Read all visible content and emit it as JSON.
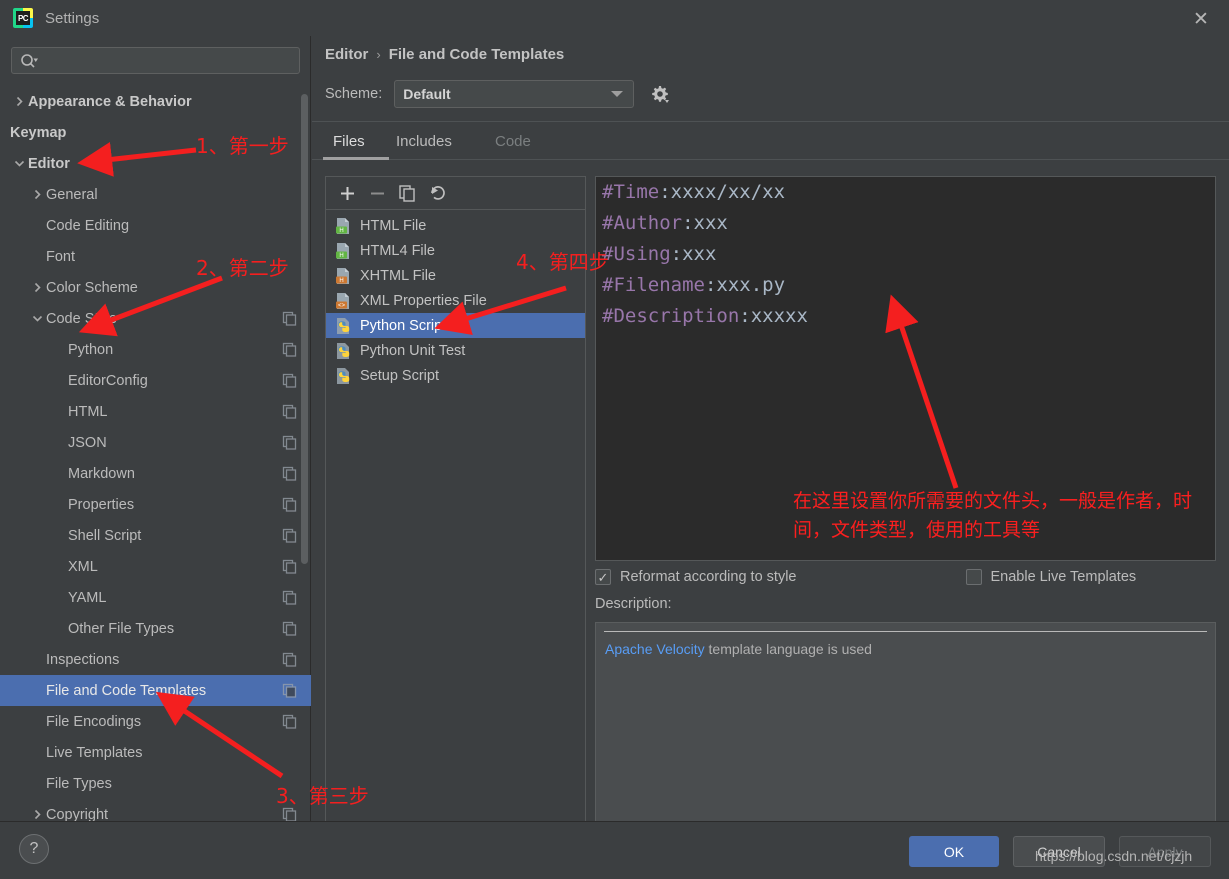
{
  "window": {
    "title": "Settings",
    "app_icon": "pycharm-icon",
    "close_icon": "close-icon"
  },
  "sidebar": {
    "search": {
      "placeholder": "",
      "value": "",
      "icon": "search-icon"
    },
    "items": [
      {
        "label": "Appearance & Behavior",
        "level": 0,
        "arrow": "collapsed",
        "bold": true,
        "copy": false,
        "selected": false
      },
      {
        "label": "Keymap",
        "level": 0,
        "arrow": "none",
        "bold": true,
        "copy": false,
        "selected": false
      },
      {
        "label": "Editor",
        "level": 0,
        "arrow": "expanded",
        "bold": true,
        "copy": false,
        "selected": false
      },
      {
        "label": "General",
        "level": 1,
        "arrow": "collapsed",
        "bold": false,
        "copy": false,
        "selected": false
      },
      {
        "label": "Code Editing",
        "level": 1,
        "arrow": "none",
        "bold": false,
        "copy": false,
        "selected": false
      },
      {
        "label": "Font",
        "level": 1,
        "arrow": "none",
        "bold": false,
        "copy": false,
        "selected": false
      },
      {
        "label": "Color Scheme",
        "level": 1,
        "arrow": "collapsed",
        "bold": false,
        "copy": false,
        "selected": false
      },
      {
        "label": "Code Style",
        "level": 1,
        "arrow": "expanded",
        "bold": false,
        "copy": true,
        "selected": false
      },
      {
        "label": "Python",
        "level": 2,
        "arrow": "none",
        "bold": false,
        "copy": true,
        "selected": false
      },
      {
        "label": "EditorConfig",
        "level": 2,
        "arrow": "none",
        "bold": false,
        "copy": true,
        "selected": false
      },
      {
        "label": "HTML",
        "level": 2,
        "arrow": "none",
        "bold": false,
        "copy": true,
        "selected": false
      },
      {
        "label": "JSON",
        "level": 2,
        "arrow": "none",
        "bold": false,
        "copy": true,
        "selected": false
      },
      {
        "label": "Markdown",
        "level": 2,
        "arrow": "none",
        "bold": false,
        "copy": true,
        "selected": false
      },
      {
        "label": "Properties",
        "level": 2,
        "arrow": "none",
        "bold": false,
        "copy": true,
        "selected": false
      },
      {
        "label": "Shell Script",
        "level": 2,
        "arrow": "none",
        "bold": false,
        "copy": true,
        "selected": false
      },
      {
        "label": "XML",
        "level": 2,
        "arrow": "none",
        "bold": false,
        "copy": true,
        "selected": false
      },
      {
        "label": "YAML",
        "level": 2,
        "arrow": "none",
        "bold": false,
        "copy": true,
        "selected": false
      },
      {
        "label": "Other File Types",
        "level": 2,
        "arrow": "none",
        "bold": false,
        "copy": true,
        "selected": false
      },
      {
        "label": "Inspections",
        "level": 1,
        "arrow": "none",
        "bold": false,
        "copy": true,
        "selected": false
      },
      {
        "label": "File and Code Templates",
        "level": 1,
        "arrow": "none",
        "bold": false,
        "copy": true,
        "selected": true
      },
      {
        "label": "File Encodings",
        "level": 1,
        "arrow": "none",
        "bold": false,
        "copy": true,
        "selected": false
      },
      {
        "label": "Live Templates",
        "level": 1,
        "arrow": "none",
        "bold": false,
        "copy": false,
        "selected": false
      },
      {
        "label": "File Types",
        "level": 1,
        "arrow": "none",
        "bold": false,
        "copy": false,
        "selected": false
      },
      {
        "label": "Copyright",
        "level": 1,
        "arrow": "collapsed",
        "bold": false,
        "copy": true,
        "selected": false
      }
    ]
  },
  "main": {
    "breadcrumb": {
      "parent": "Editor",
      "separator": "›",
      "current": "File and Code Templates"
    },
    "scheme": {
      "label": "Scheme:",
      "value": "Default",
      "gear_icon": "gear-icon"
    },
    "tabs": [
      {
        "label": "Files",
        "state": "active"
      },
      {
        "label": "Includes",
        "state": "normal"
      },
      {
        "label": "Code",
        "state": "disabled"
      }
    ],
    "file_toolbar": [
      {
        "name": "add-button",
        "glyph": "+"
      },
      {
        "name": "remove-button",
        "glyph": "−"
      },
      {
        "name": "copy-button",
        "glyph": "copy"
      },
      {
        "name": "reset-button",
        "glyph": "undo"
      }
    ],
    "files": [
      {
        "label": "HTML File",
        "icon": "html-file-icon",
        "selected": false
      },
      {
        "label": "HTML4 File",
        "icon": "html-file-icon",
        "selected": false
      },
      {
        "label": "XHTML File",
        "icon": "xhtml-file-icon",
        "selected": false
      },
      {
        "label": "XML Properties File",
        "icon": "xml-file-icon",
        "selected": false
      },
      {
        "label": "Python Script",
        "icon": "python-icon",
        "selected": true
      },
      {
        "label": "Python Unit Test",
        "icon": "python-icon",
        "selected": false
      },
      {
        "label": "Setup Script",
        "icon": "python-icon",
        "selected": false
      }
    ],
    "editor_lines": [
      {
        "key": "#Time",
        "rest": ":xxxx/xx/xx"
      },
      {
        "key": "#Author",
        "rest": ":xxx"
      },
      {
        "key": "#Using",
        "rest": ":xxx"
      },
      {
        "key": "#Filename",
        "rest": ":xxx.py"
      },
      {
        "key": "#Description",
        "rest": ":xxxxx"
      }
    ],
    "checkboxes": [
      {
        "label": "Reformat according to style",
        "checked": true
      },
      {
        "label": "Enable Live Templates",
        "checked": false
      }
    ],
    "description": {
      "label": "Description:",
      "link_text": "Apache Velocity",
      "rest_text": " template language is used"
    }
  },
  "footer": {
    "help_label": "?",
    "ok_label": "OK",
    "cancel_label": "Cancel",
    "apply_label": "Apply",
    "watermark": "https://blog.csdn.net/cjzjh"
  },
  "annotations": {
    "step1": "1、第一步",
    "step2": "2、第二步",
    "step3": "3、第三步",
    "step4": "4、第四步",
    "note": "在这里设置你所需要的文件头，一般是作者，时间，文件类型，使用的工具等",
    "color": "#f41f1f"
  }
}
